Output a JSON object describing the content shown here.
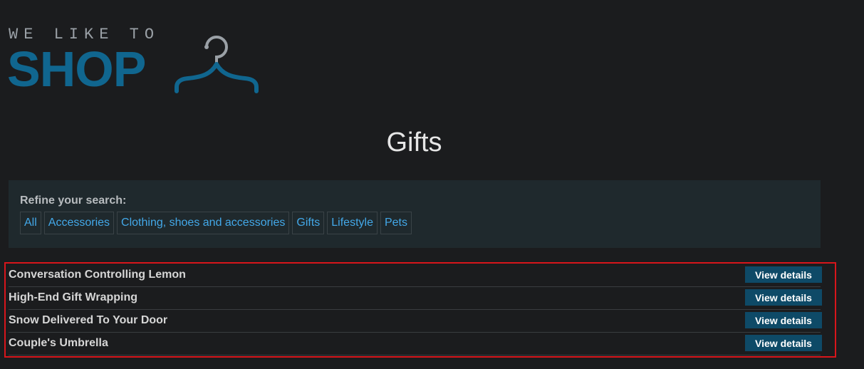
{
  "logo": {
    "top_text": "WE LIKE TO",
    "main_text": "SHOP"
  },
  "page_title": "Gifts",
  "refine": {
    "label": "Refine your search:",
    "filters": [
      "All",
      "Accessories",
      "Clothing, shoes and accessories",
      "Gifts",
      "Lifestyle",
      "Pets"
    ]
  },
  "products": [
    {
      "name": "Conversation Controlling Lemon",
      "button": "View details"
    },
    {
      "name": "High-End Gift Wrapping",
      "button": "View details"
    },
    {
      "name": "Snow Delivered To Your Door",
      "button": "View details"
    },
    {
      "name": "Couple's Umbrella",
      "button": "View details"
    }
  ],
  "colors": {
    "accent": "#10668f",
    "link": "#43a8e8",
    "highlight_border": "#d8151b",
    "button_bg": "#0e4a67"
  },
  "icons": {
    "logo_icon": "hanger-icon"
  }
}
